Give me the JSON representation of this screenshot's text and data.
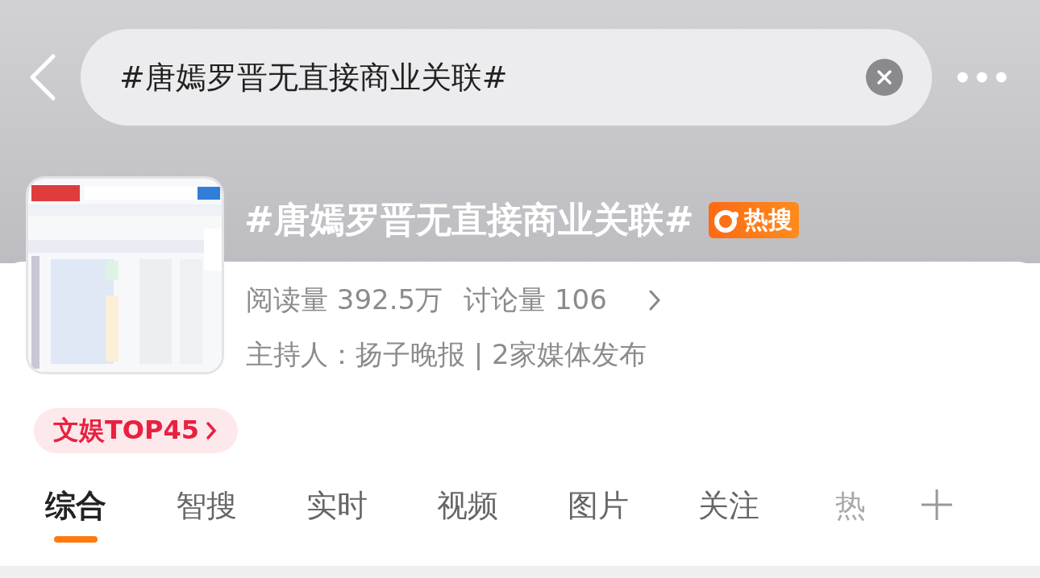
{
  "search": {
    "value": "#唐嫣罗晋无直接商业关联#"
  },
  "topic": {
    "title": "#唐嫣罗晋无直接商业关联#",
    "badge": "热搜",
    "stats": [
      "阅读量 392.5万",
      "讨论量 106"
    ],
    "host": "主持人：扬子晚报 | 2家媒体发布",
    "rank": "文娱TOP45"
  },
  "tabs": [
    {
      "label": "综合",
      "selected": true
    },
    {
      "label": "智搜",
      "selected": false
    },
    {
      "label": "实时",
      "selected": false
    },
    {
      "label": "视频",
      "selected": false
    },
    {
      "label": "图片",
      "selected": false
    },
    {
      "label": "关注",
      "selected": false
    },
    {
      "label": "热",
      "selected": false
    }
  ]
}
